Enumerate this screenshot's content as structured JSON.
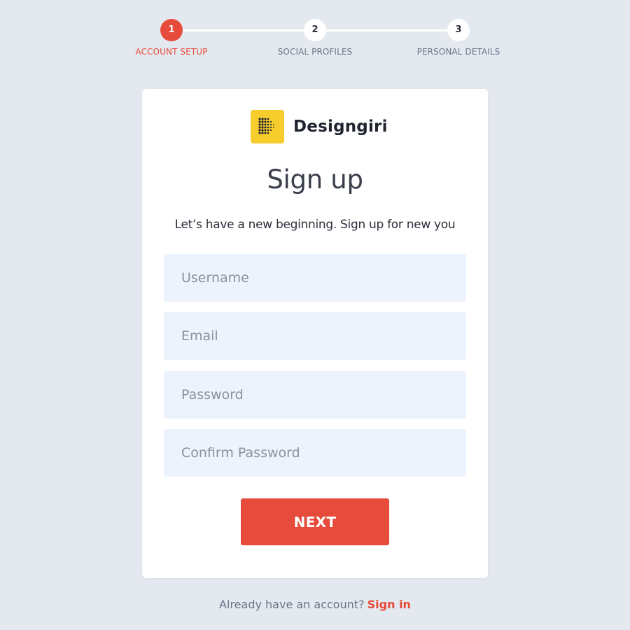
{
  "stepper": {
    "steps": [
      {
        "number": "1",
        "label": "ACCOUNT SETUP",
        "active": true
      },
      {
        "number": "2",
        "label": "SOCIAL PROFILES",
        "active": false
      },
      {
        "number": "3",
        "label": "PERSONAL DETAILS",
        "active": false
      }
    ]
  },
  "brand": {
    "name": "Designgiri",
    "logo_icon": "dot-grid-icon"
  },
  "form": {
    "title": "Sign up",
    "subtitle": "Let’s have a new beginning. Sign up for new you",
    "username_placeholder": "Username",
    "email_placeholder": "Email",
    "password_placeholder": "Password",
    "confirm_password_placeholder": "Confirm Password",
    "username_value": "",
    "email_value": "",
    "password_value": "",
    "confirm_password_value": "",
    "next_label": "NEXT"
  },
  "footer": {
    "prompt": "Already have an account?",
    "signin_label": "Sign in"
  },
  "colors": {
    "background": "#e4e8ef",
    "accent": "#e64b3b",
    "logo": "#f7cc2d",
    "field_bg": "#edf3fd"
  }
}
